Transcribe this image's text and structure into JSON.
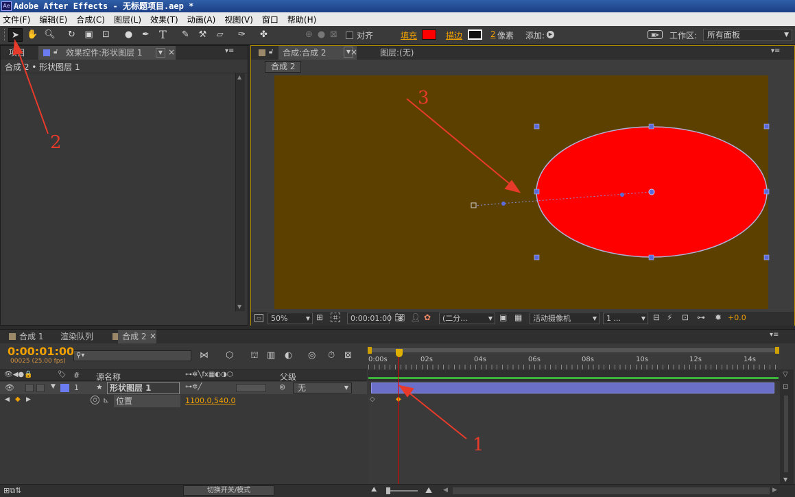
{
  "title": "Adobe After Effects - 无标题项目.aep *",
  "logo": "Ae",
  "menu": [
    "文件(F)",
    "编辑(E)",
    "合成(C)",
    "图层(L)",
    "效果(T)",
    "动画(A)",
    "视图(V)",
    "窗口",
    "帮助(H)"
  ],
  "toolbar": {
    "align_label": "对齐",
    "fill_label": "填充",
    "stroke_label": "描边",
    "stroke_width": "2",
    "stroke_unit": "像素",
    "add_label": "添加:",
    "workspace_label": "工作区:",
    "workspace_value": "所有面板",
    "fill_color": "#ff0000"
  },
  "left_panel": {
    "tab_project": "项目",
    "tab_effects": "效果控件:形状图层 1",
    "breadcrumb": "合成 2 • 形状图层 1"
  },
  "comp_panel": {
    "tab_comp": "合成:合成 2",
    "tab_layer": "图层:(无)",
    "comp_button": "合成 2",
    "zoom": "50%",
    "timecode": "0:00:01:00",
    "resolution": "(二分...",
    "camera": "活动摄像机",
    "views": "1 ...",
    "exposure": "+0.0"
  },
  "timeline": {
    "tabs": [
      "合成 1",
      "渲染队列",
      "合成 2"
    ],
    "timecode": "0:00:01:00",
    "frames": "00025 (25.00 fps)",
    "col_source": "源名称",
    "col_parent": "父级",
    "layer_num": "1",
    "layer_name": "形状图层 1",
    "parent_value": "无",
    "prop_name": "位置",
    "prop_value": "1100.0,540.0",
    "ruler_labels": [
      "0:00s",
      "02s",
      "04s",
      "06s",
      "08s",
      "10s",
      "12s",
      "14s"
    ],
    "toggle_label": "切换开关/模式"
  },
  "annotations": [
    "1",
    "2",
    "3"
  ],
  "colors": {
    "comp_bg": "#5b4000",
    "ellipse": "#ff0000",
    "layer_bar": "#6b6fc8",
    "playhead": "#e00000",
    "annotation": "#e83a2a"
  }
}
